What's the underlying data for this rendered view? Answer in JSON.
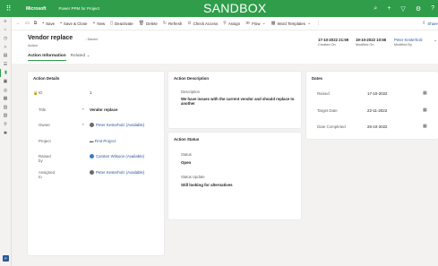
{
  "topbar": {
    "brand": "Microsoft",
    "app": "Power PPM for Project",
    "env": "SANDBOX",
    "icons": [
      "search-icon",
      "add-icon",
      "filter-icon",
      "settings-icon",
      "help-icon"
    ]
  },
  "leftnav": {
    "items": [
      "menu-icon",
      "home-icon",
      "recent-icon",
      "pinned-icon",
      "list-icon",
      "action-icon",
      "portfolio-icon",
      "program-icon",
      "project-icon",
      "report-icon",
      "risk-icon",
      "issue-icon",
      "settings-icon",
      "more-icon"
    ],
    "bottom_label": "P"
  },
  "cmdbar": {
    "items": [
      {
        "label": "Save",
        "icon": "save-icon"
      },
      {
        "label": "Save & Close",
        "icon": "save-close-icon"
      },
      {
        "label": "New",
        "icon": "plus-icon"
      },
      {
        "label": "Deactivate",
        "icon": "deactivate-icon"
      },
      {
        "label": "Delete",
        "icon": "delete-icon"
      },
      {
        "label": "Refresh",
        "icon": "refresh-icon"
      },
      {
        "label": "Check Access",
        "icon": "check-access-icon"
      },
      {
        "label": "Assign",
        "icon": "assign-icon"
      },
      {
        "label": "Flow",
        "icon": "flow-icon"
      },
      {
        "label": "Word Templates",
        "icon": "word-icon"
      }
    ],
    "share": "Share"
  },
  "header": {
    "title": "Vendor replace",
    "saved": "- Saved",
    "subtitle": "Action",
    "created_on": "17-10-2022 21:59",
    "created_on_label": "Created On",
    "modified_on": "19-10-2022 10:56",
    "modified_on_label": "Modified On",
    "modified_by": "Peter Kesterholz",
    "modified_by_label": "Modified By"
  },
  "tabs": [
    {
      "label": "Action Information"
    },
    {
      "label": "Related"
    }
  ],
  "action_details": {
    "title": "Action Details",
    "rows": [
      {
        "label": "ID",
        "value": "1"
      },
      {
        "label": "Title",
        "value": "Vendor replace"
      },
      {
        "label": "Owner",
        "value": "Peter Kesterholz (Available)"
      },
      {
        "label": "Project",
        "value": "First Project"
      },
      {
        "label": "Raised by",
        "value": "Carsten Wilsonn (Available)"
      },
      {
        "label": "Assigned to",
        "value": "Peter Kesterholz (Available)"
      }
    ]
  },
  "action_description": {
    "title": "Action Description",
    "label": "Description",
    "value": "We have issues with the current vendor and should replace to another"
  },
  "action_status": {
    "title": "Action Status",
    "status_label": "Status",
    "status_value": "Open",
    "update_label": "Status Update",
    "update_value": "Still looking for alternatives"
  },
  "dates": {
    "title": "Dates",
    "rows": [
      {
        "label": "Raised",
        "value": "17-10-2022"
      },
      {
        "label": "Target Date",
        "value": "22-11-2022"
      },
      {
        "label": "Date Completed",
        "value": "26-10-2022"
      }
    ]
  }
}
